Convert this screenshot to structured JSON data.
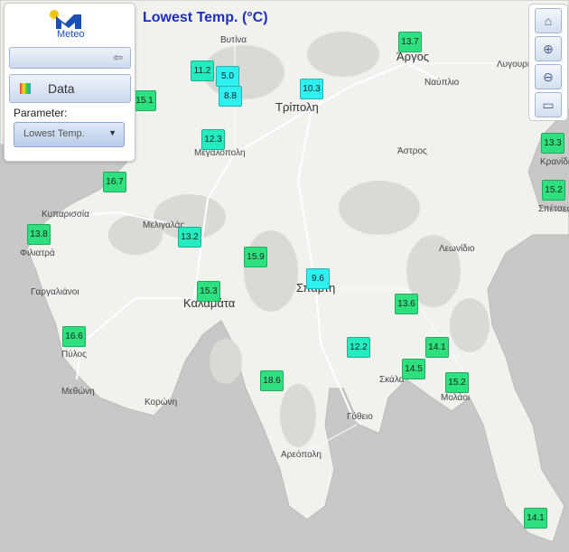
{
  "title": "Lowest Temp. (°C)",
  "panel": {
    "logo_text": "Meteo",
    "data_label": "Data",
    "parameter_label": "Parameter:",
    "parameter_value": "Lowest Temp."
  },
  "tools": {
    "home": "home-icon",
    "zoom_in": "zoom-in-icon",
    "zoom_out": "zoom-out-icon",
    "extent": "zoom-extent-icon"
  },
  "places": [
    {
      "id": "vytina",
      "name": "Βυτίνα"
    },
    {
      "id": "argos",
      "name": "Άργος"
    },
    {
      "id": "lygourio",
      "name": "Λυγουριό"
    },
    {
      "id": "nafplio",
      "name": "Ναύπλιο"
    },
    {
      "id": "tripoli",
      "name": "Τρίπολη"
    },
    {
      "id": "megalopoli",
      "name": "Μεγαλόπολη"
    },
    {
      "id": "astros",
      "name": "Άστρος"
    },
    {
      "id": "kranidi",
      "name": "Κρανίδι"
    },
    {
      "id": "spetses",
      "name": "Σπέτσες"
    },
    {
      "id": "kyparissia",
      "name": "Κυπαρισσία"
    },
    {
      "id": "meligalas",
      "name": "Μελιγαλάς"
    },
    {
      "id": "filiatra",
      "name": "Φιλιατρά"
    },
    {
      "id": "leonidio",
      "name": "Λεωνίδιο"
    },
    {
      "id": "gargalianoi",
      "name": "Γαργαλιάνοι"
    },
    {
      "id": "kalamata",
      "name": "Καλαμάτα"
    },
    {
      "id": "sparti",
      "name": "Σπάρτη"
    },
    {
      "id": "pylos",
      "name": "Πύλος"
    },
    {
      "id": "skala",
      "name": "Σκάλα"
    },
    {
      "id": "molaoi",
      "name": "Μολάοι"
    },
    {
      "id": "methoni",
      "name": "Μεθώνη"
    },
    {
      "id": "koroni",
      "name": "Κορώνη"
    },
    {
      "id": "gytheio",
      "name": "Γύθειο"
    },
    {
      "id": "areopoli",
      "name": "Αρεόπολη"
    }
  ],
  "markers": [
    {
      "value": "13.7",
      "color": "green"
    },
    {
      "value": "11.2",
      "color": "teal"
    },
    {
      "value": "5.0",
      "color": "cyan"
    },
    {
      "value": "8.8",
      "color": "cyan"
    },
    {
      "value": "10.3",
      "color": "cyan"
    },
    {
      "value": "15.1",
      "color": "green"
    },
    {
      "value": "12.3",
      "color": "teal"
    },
    {
      "value": "13.3",
      "color": "green"
    },
    {
      "value": "15.2",
      "color": "green"
    },
    {
      "value": "16.7",
      "color": "green"
    },
    {
      "value": "13.8",
      "color": "green"
    },
    {
      "value": "13.2",
      "color": "teal"
    },
    {
      "value": "15.9",
      "color": "green"
    },
    {
      "value": "9.6",
      "color": "cyan"
    },
    {
      "value": "15.3",
      "color": "green"
    },
    {
      "value": "13.6",
      "color": "green"
    },
    {
      "value": "16.6",
      "color": "green"
    },
    {
      "value": "12.2",
      "color": "teal"
    },
    {
      "value": "14.1",
      "color": "green"
    },
    {
      "value": "14.5",
      "color": "green"
    },
    {
      "value": "15.2",
      "color": "green"
    },
    {
      "value": "18.6",
      "color": "green"
    },
    {
      "value": "14.1",
      "color": "green"
    }
  ],
  "colors": {
    "green": "#2fe07f",
    "teal": "#22ecc0",
    "cyan": "#2ef0f0",
    "title": "#1d2dbd"
  }
}
